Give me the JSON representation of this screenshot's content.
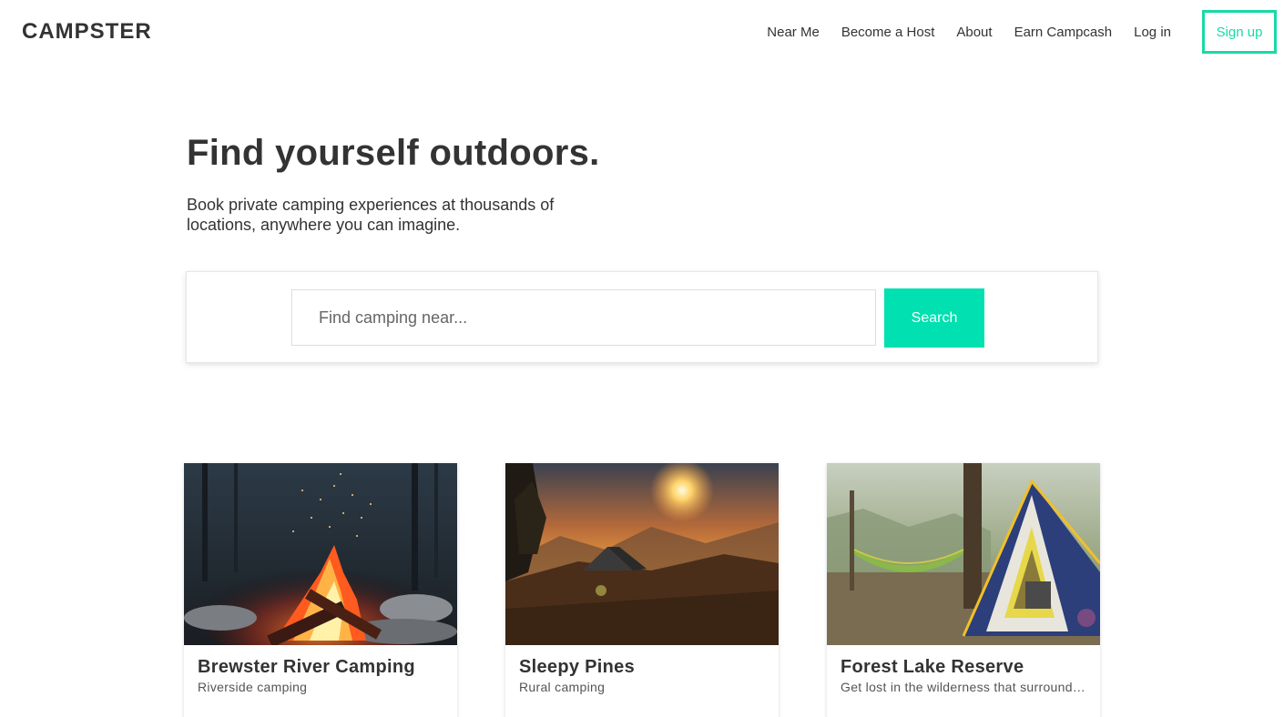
{
  "header": {
    "logo": "CAMPSTER",
    "nav": [
      "Near Me",
      "Become a Host",
      "About",
      "Earn Campcash",
      "Log in"
    ],
    "signup": "Sign up"
  },
  "hero": {
    "title": "Find yourself outdoors.",
    "subtitle": "Book private camping experiences at thousands of locations, anywhere you can imagine."
  },
  "search": {
    "placeholder": "Find camping near...",
    "button": "Search"
  },
  "cards": [
    {
      "title": "Brewster River Camping",
      "description": "Riverside camping",
      "image": "campfire-photo"
    },
    {
      "title": "Sleepy Pines",
      "description": "Rural camping",
      "image": "sunset-tent-photo"
    },
    {
      "title": "Forest Lake Reserve",
      "description": "Get lost in the wilderness that surrounds Forest Lake Reserve",
      "image": "tent-hammock-photo"
    }
  ],
  "colors": {
    "accent": "#00e0b0",
    "signup_border": "#19d9a8",
    "text": "#333333"
  }
}
